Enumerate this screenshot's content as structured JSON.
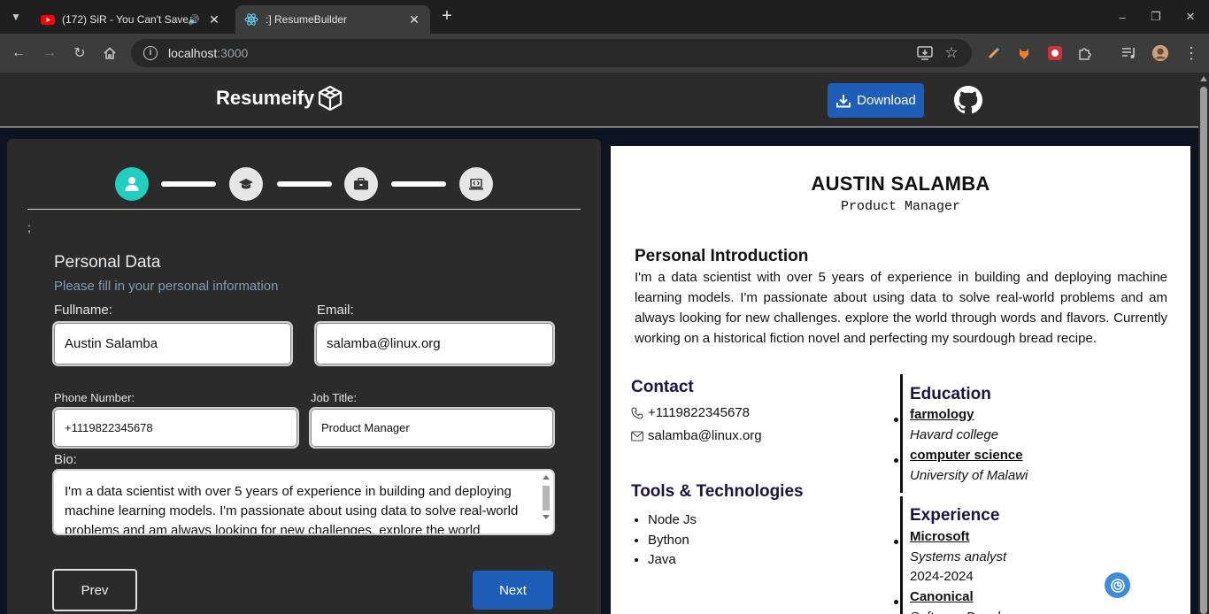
{
  "browser": {
    "tabs": [
      {
        "title": "(172) SiR - You Can't Save",
        "active": false,
        "has_audio": true
      },
      {
        "title": ":] ResumeBuilder",
        "active": true,
        "has_audio": false
      }
    ],
    "address": {
      "host": "localhost",
      "port": ":3000"
    }
  },
  "header": {
    "brand": "Resumeify",
    "download_label": "Download"
  },
  "form": {
    "steps": [
      "person-icon",
      "graduation-cap-icon",
      "briefcase-icon",
      "laptop-code-icon"
    ],
    "active_step": 0,
    "stray_text": ";",
    "section_title": "Personal Data",
    "section_subtitle": "Please fill in your personal information",
    "fields": {
      "fullname": {
        "label": "Fullname:",
        "value": "Austin Salamba"
      },
      "email": {
        "label": "Email:",
        "value": "salamba@linux.org"
      },
      "phone": {
        "label": "Phone Number:",
        "value": "+1119822345678"
      },
      "job": {
        "label": "Job Title:",
        "value": "Product Manager"
      },
      "bio": {
        "label": "Bio:",
        "value": "I'm a data scientist with over 5 years of experience in building and deploying machine learning models. I'm passionate about using data to solve real-world problems and am always looking for new challenges. explore the world"
      }
    },
    "prev_label": "Prev",
    "next_label": "Next"
  },
  "resume": {
    "name": "AUSTIN SALAMBA",
    "job_title": "Product Manager",
    "intro_heading": "Personal Introduction",
    "intro_text": "I'm a data scientist with over 5 years of experience in building and deploying machine learning models. I'm passionate about using data to solve real-world problems and am always looking for new challenges. explore the world through words and flavors. Currently working on a historical fiction novel and perfecting my sourdough bread recipe.",
    "contact_heading": "Contact",
    "phone": "+1119822345678",
    "email": "salamba@linux.org",
    "tools_heading": "Tools & Technologies",
    "tools": [
      "Node Js",
      "Bython",
      "Java"
    ],
    "education_heading": "Education",
    "education": [
      {
        "course": "farmology",
        "school": "Havard college"
      },
      {
        "course": "computer science",
        "school": "University of Malawi"
      }
    ],
    "experience_heading": "Experience",
    "experience": [
      {
        "company": "Microsoft",
        "role": "Systems analyst",
        "years": "2024-2024"
      },
      {
        "company": "Canonical",
        "role": "Software Developer"
      }
    ]
  }
}
